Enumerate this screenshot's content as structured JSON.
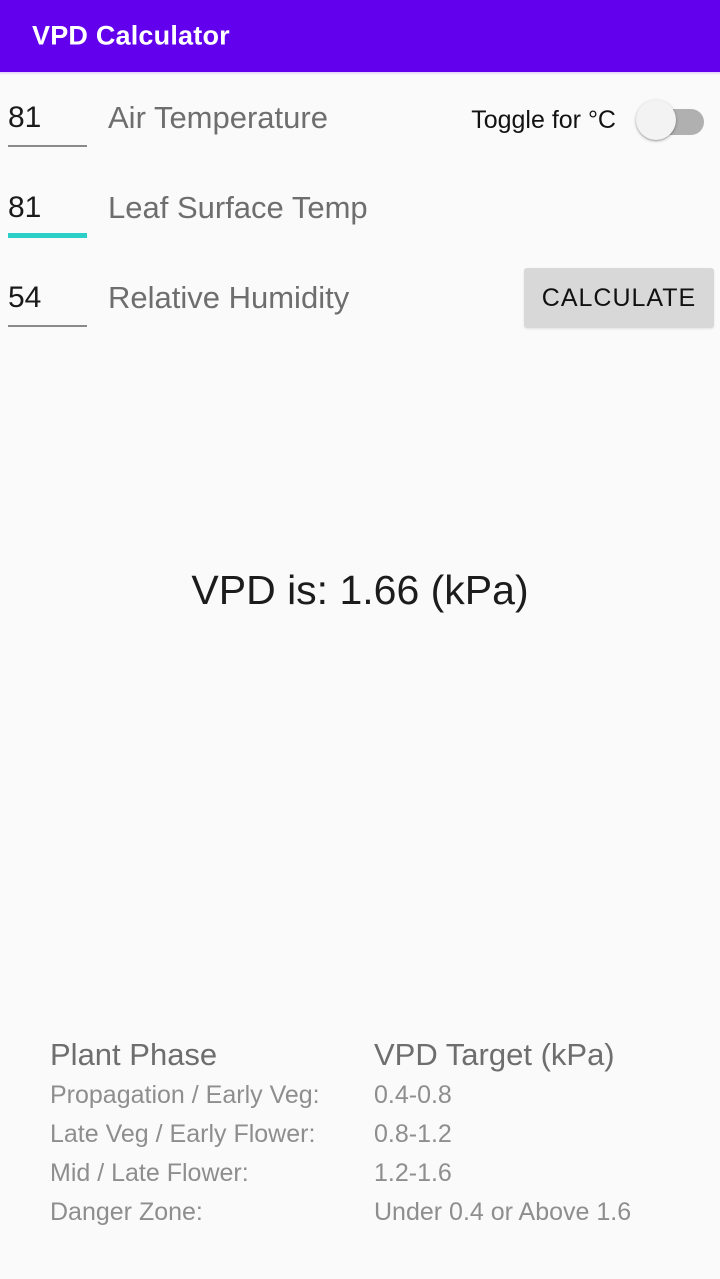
{
  "app_bar": {
    "title": "VPD Calculator",
    "background_color": "#6200EE",
    "title_color": "#FFFFFF"
  },
  "form": {
    "fields": [
      {
        "name": "air-temperature",
        "value": "81",
        "placeholder": "",
        "label": "Air Temperature",
        "focused": false,
        "underline_color": "#8A8A8A"
      },
      {
        "name": "leaf-surface-temp",
        "value": "81",
        "placeholder": "",
        "label": "Leaf Surface Temp",
        "focused": true,
        "underline_color": "#2BCFC8"
      },
      {
        "name": "relative-humidity",
        "value": "54",
        "placeholder": "",
        "label": "Relative Humidity",
        "focused": false,
        "underline_color": "#8A8A8A"
      }
    ],
    "unit_toggle": {
      "label": "Toggle for °C",
      "state": "off",
      "track_color": "#B0B0B0",
      "thumb_color": "#F3F3F3"
    },
    "calculate_button": {
      "label": "CALCULATE",
      "background_color": "#D8D8D8",
      "text_color": "#111111"
    }
  },
  "result": {
    "text": "VPD is: 1.66 (kPa)",
    "value": "1.66",
    "unit": "kPa"
  },
  "phase_table": {
    "headers": {
      "phase": "Plant Phase",
      "target": "VPD Target (kPa)"
    },
    "rows": [
      {
        "phase": "Propagation / Early Veg:",
        "target": "0.4-0.8"
      },
      {
        "phase": "Late Veg / Early Flower:",
        "target": "0.8-1.2"
      },
      {
        "phase": "Mid / Late Flower:",
        "target": "1.2-1.6"
      },
      {
        "phase": "Danger Zone:",
        "target": "Under 0.4 or Above 1.6"
      }
    ]
  },
  "theme": {
    "page_background": "#FAFAFA",
    "primary": "#6200EE",
    "accent": "#2BCFC8",
    "label_text": "#6E6E6E",
    "muted_text": "#8E8E8E"
  }
}
